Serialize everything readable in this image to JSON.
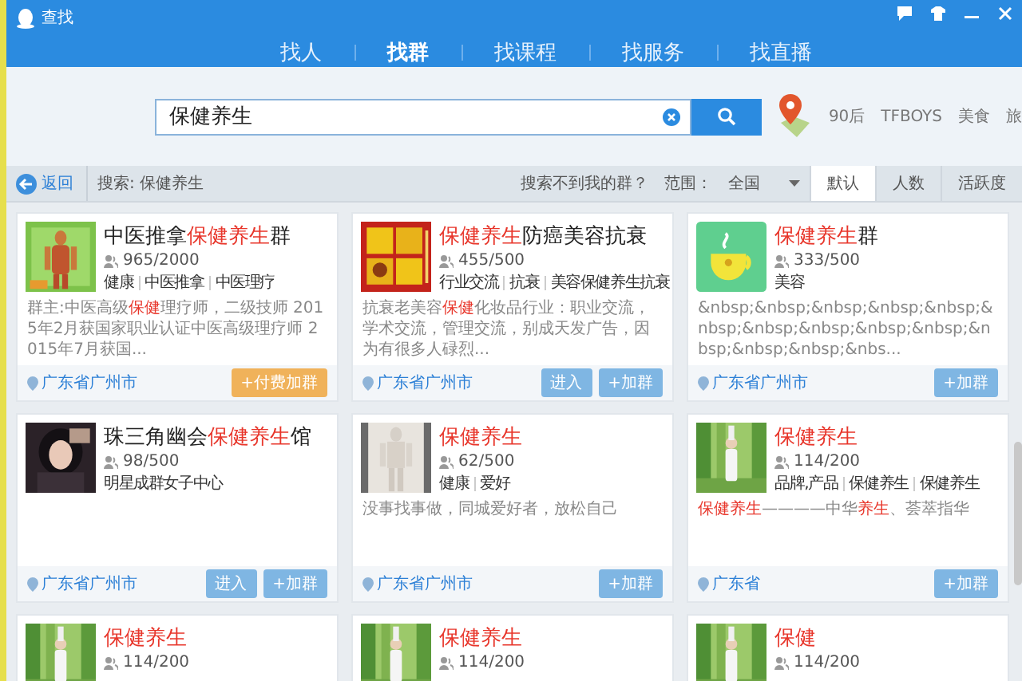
{
  "window": {
    "title": "查找"
  },
  "tabs": [
    {
      "label": "找人",
      "selected": false
    },
    {
      "label": "找群",
      "selected": true
    },
    {
      "label": "找课程",
      "selected": false
    },
    {
      "label": "找服务",
      "selected": false
    },
    {
      "label": "找直播",
      "selected": false
    }
  ],
  "search": {
    "value": "保健养生"
  },
  "hot_words": [
    "90后",
    "TFBOYS",
    "美食",
    "旅"
  ],
  "toolbar": {
    "back": "返回",
    "query": "搜索: 保健养生",
    "help": "搜索不到我的群？",
    "range_label": "范围：",
    "range_value": "全国",
    "sort_tabs": [
      {
        "label": "默认",
        "selected": true
      },
      {
        "label": "人数",
        "selected": false
      },
      {
        "label": "活跃度",
        "selected": false
      }
    ]
  },
  "cards": [
    {
      "title": [
        {
          "text": "中医推拿",
          "hit": false
        },
        {
          "text": "保健养生",
          "hit": true
        },
        {
          "text": "群",
          "hit": false
        }
      ],
      "members": "965/2000",
      "tags": [
        "健康",
        "中医推拿",
        "中医理疗"
      ],
      "description": [
        {
          "text": "群主:中医高级",
          "hit": false
        },
        {
          "text": "保健",
          "hit": true
        },
        {
          "text": "理疗师，二级技师 2015年2月获国家职业认证中医高级理疗师 2015年7月获国...",
          "hit": false
        }
      ],
      "location": "广东省广州市",
      "buttons": [
        {
          "label": "+付费加群",
          "kind": "pay"
        }
      ]
    },
    {
      "title": [
        {
          "text": "保健养生",
          "hit": true
        },
        {
          "text": "防癌美容抗衰",
          "hit": false
        }
      ],
      "members": "455/500",
      "tags": [
        "行业交流",
        "抗衰",
        "美容保健养生抗衰"
      ],
      "description": [
        {
          "text": "抗衰老美容",
          "hit": false
        },
        {
          "text": "保健",
          "hit": true
        },
        {
          "text": "化妆品行业：职业交流，学术交流，管理交流，别成天发广告，因为有很多人碌烈...",
          "hit": false
        }
      ],
      "location": "广东省广州市",
      "buttons": [
        {
          "label": "进入",
          "kind": "enter"
        },
        {
          "label": "+加群",
          "kind": "join"
        }
      ]
    },
    {
      "title": [
        {
          "text": "保健养生",
          "hit": true
        },
        {
          "text": "群",
          "hit": false
        }
      ],
      "members": "333/500",
      "tags": [
        "美容"
      ],
      "description": [
        {
          "text": "&nbsp;&nbsp;&nbsp;&nbsp;&nbsp;&nbsp;&nbsp;&nbsp;&nbsp;&nbsp;&nbsp;&nbsp;&nbsp;&nbs...",
          "hit": false
        }
      ],
      "location": "广东省广州市",
      "buttons": [
        {
          "label": "+加群",
          "kind": "join"
        }
      ]
    },
    {
      "title": [
        {
          "text": "珠三角幽会",
          "hit": false
        },
        {
          "text": "保健养生",
          "hit": true
        },
        {
          "text": "馆",
          "hit": false
        }
      ],
      "members": "98/500",
      "tags": [
        "明星成群女子中心"
      ],
      "location": "广东省广州市",
      "buttons": [
        {
          "label": "进入",
          "kind": "enter"
        },
        {
          "label": "+加群",
          "kind": "join"
        }
      ]
    },
    {
      "title": [
        {
          "text": "保健养生",
          "hit": true
        }
      ],
      "members": "62/500",
      "tags": [
        "健康",
        "爱好"
      ],
      "description": [
        {
          "text": "没事找事做，同城爱好者，放松自己",
          "hit": false
        }
      ],
      "location": "广东省广州市",
      "buttons": [
        {
          "label": "+加群",
          "kind": "join"
        }
      ]
    },
    {
      "title": [
        {
          "text": "保健养生",
          "hit": true
        }
      ],
      "members": "114/200",
      "tags": [
        "品牌,产品",
        "保健养生",
        "保健养生"
      ],
      "description": [
        {
          "text": "保健养生",
          "hit": true
        },
        {
          "text": "————中华",
          "hit": false
        },
        {
          "text": "养生",
          "hit": true
        },
        {
          "text": "、荟萃指华",
          "hit": false
        }
      ],
      "location": "广东省",
      "buttons": [
        {
          "label": "+加群",
          "kind": "join"
        }
      ]
    },
    {
      "title": [
        {
          "text": "保健养生",
          "hit": true
        }
      ],
      "members": "114/200"
    },
    {
      "title": [
        {
          "text": "保健养生",
          "hit": true
        }
      ],
      "members": "114/200"
    },
    {
      "title": [
        {
          "text": "保健",
          "hit": true
        }
      ],
      "members": "114/200"
    }
  ]
}
